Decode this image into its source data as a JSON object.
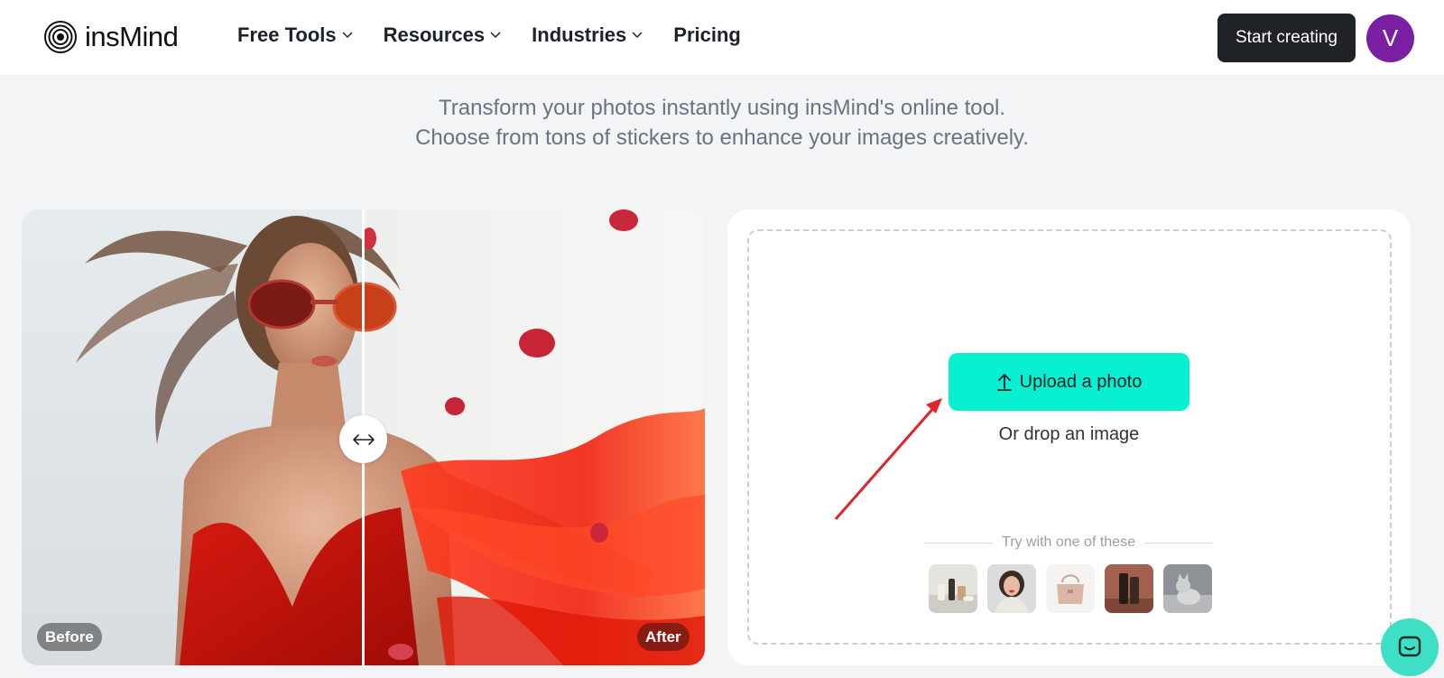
{
  "header": {
    "logo_text": "insMind",
    "nav": [
      {
        "label": "Free Tools",
        "has_dropdown": true
      },
      {
        "label": "Resources",
        "has_dropdown": true
      },
      {
        "label": "Industries",
        "has_dropdown": true
      },
      {
        "label": "Pricing",
        "has_dropdown": false
      }
    ],
    "cta_label": "Start creating",
    "avatar_initial": "V",
    "avatar_color": "#7b1fa2"
  },
  "hero": {
    "subtitle_line1": "Transform your photos instantly using insMind's online tool.",
    "subtitle_line2": "Choose from tons of stickers to enhance your images creatively."
  },
  "compare": {
    "before_label": "Before",
    "after_label": "After"
  },
  "upload": {
    "button_label": "Upload a photo",
    "drop_text": "Or drop an image",
    "try_label": "Try with one of these",
    "samples": [
      "sample-cosmetics",
      "sample-woman-portrait",
      "sample-handbag",
      "sample-bottles",
      "sample-cat"
    ]
  },
  "colors": {
    "accent": "#08f0cf",
    "dark_button": "#1f2328",
    "arrow": "#e0242b",
    "chat": "#3de0c4"
  }
}
